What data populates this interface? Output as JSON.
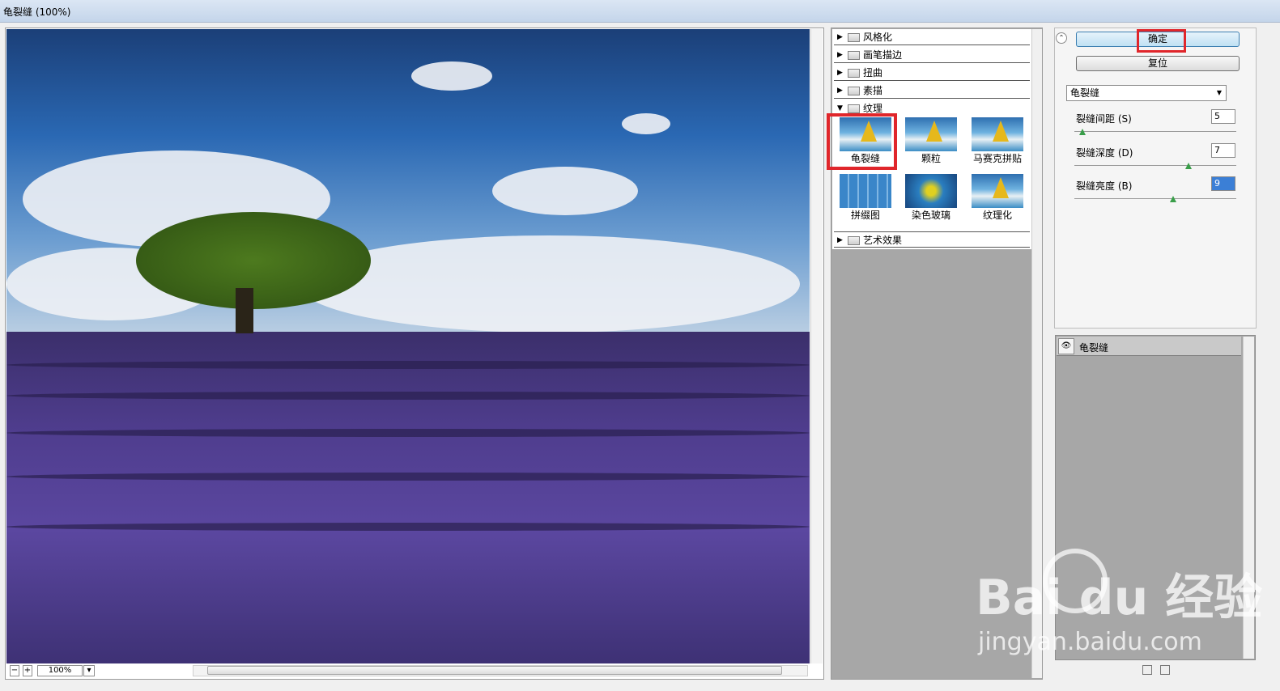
{
  "window": {
    "title": "龟裂缝 (100%)"
  },
  "preview": {
    "zoom": "100%",
    "zoom_out_glyph": "−",
    "zoom_in_glyph": "+",
    "dropdown_glyph": "▾"
  },
  "gallery": {
    "categories": [
      {
        "label": "风格化",
        "expanded": false
      },
      {
        "label": "画笔描边",
        "expanded": false
      },
      {
        "label": "扭曲",
        "expanded": false
      },
      {
        "label": "素描",
        "expanded": false
      },
      {
        "label": "纹理",
        "expanded": true
      },
      {
        "label": "艺术效果",
        "expanded": false
      }
    ],
    "texture_filters": [
      "龟裂缝",
      "颗粒",
      "马赛克拼贴",
      "拼缀图",
      "染色玻璃",
      "纹理化"
    ],
    "selected_filter": "龟裂缝"
  },
  "actions": {
    "ok_label": "确定",
    "reset_label": "复位"
  },
  "settings": {
    "filter_select": "龟裂缝",
    "params": [
      {
        "label": "裂缝间距 (S)",
        "value": "5",
        "fraction": 0.03
      },
      {
        "label": "裂缝深度 (D)",
        "value": "7",
        "fraction": 0.7
      },
      {
        "label": "裂缝亮度 (B)",
        "value": "9",
        "fraction": 0.6
      }
    ]
  },
  "layers": {
    "items": [
      {
        "label": "龟裂缝",
        "visible": true
      }
    ]
  },
  "watermark": {
    "brand": "Bai du 经验",
    "url": "jingyan.baidu.com"
  },
  "colors": {
    "highlight_red": "#e0262b",
    "ok_button": "#bfe0f3",
    "panel_gray": "#a7a7a7"
  }
}
